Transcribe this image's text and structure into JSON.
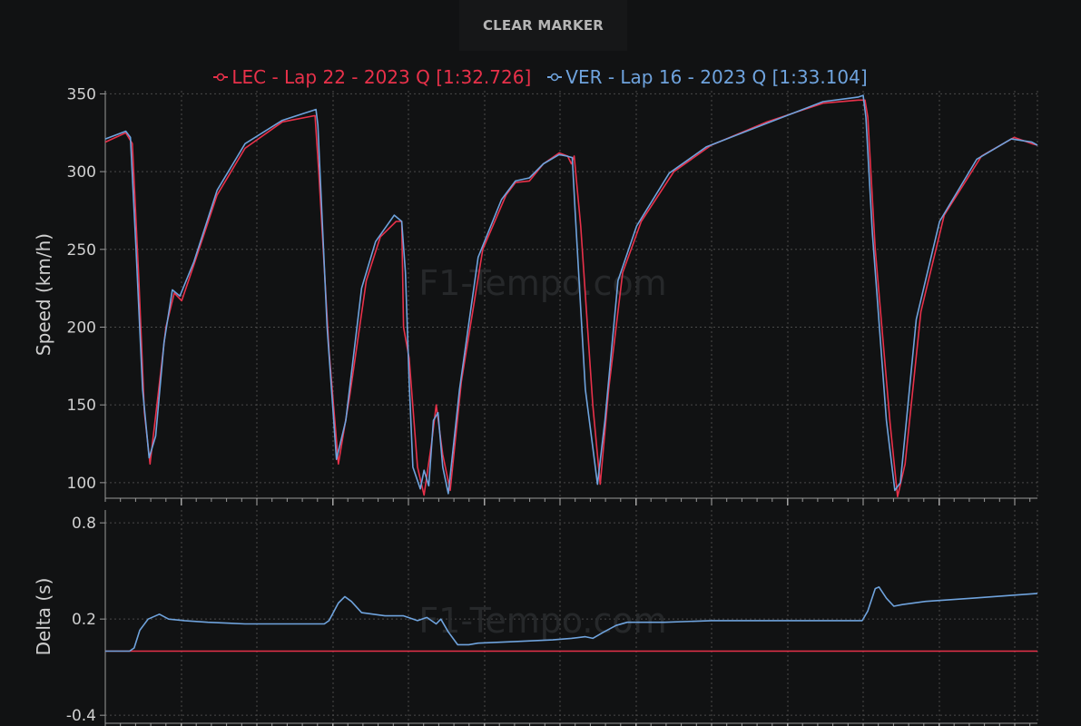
{
  "toolbar": {
    "clear_marker_label": "CLEAR MARKER"
  },
  "watermark": "F1-Tempo.com",
  "colors": {
    "lec": "#e8314a",
    "ver": "#6fa3dd",
    "grid": "#555",
    "axis": "#888"
  },
  "legend": [
    {
      "label": "LEC - Lap 22 - 2023 Q [1:32.726]",
      "color": "#e8314a"
    },
    {
      "label": "VER - Lap 16 - 2023 Q [1:33.104]",
      "color": "#6fa3dd"
    }
  ],
  "chart_data": [
    {
      "type": "line",
      "ylabel": "Speed (km/h)",
      "ylim": [
        90,
        352
      ],
      "xlim": [
        0,
        1
      ],
      "yticks": [
        100,
        150,
        200,
        250,
        300,
        350
      ],
      "grid": true,
      "series": [
        {
          "name": "LEC - Lap 22 - 2023 Q [1:32.726]",
          "color": "#e8314a",
          "points": [
            [
              0,
              319
            ],
            [
              0.022,
              325
            ],
            [
              0.029,
              318
            ],
            [
              0.036,
              230
            ],
            [
              0.042,
              145
            ],
            [
              0.048,
              112
            ],
            [
              0.055,
              148
            ],
            [
              0.065,
              200
            ],
            [
              0.074,
              222
            ],
            [
              0.082,
              217
            ],
            [
              0.095,
              240
            ],
            [
              0.12,
              285
            ],
            [
              0.15,
              315
            ],
            [
              0.19,
              332
            ],
            [
              0.225,
              336
            ],
            [
              0.229,
              300
            ],
            [
              0.24,
              185
            ],
            [
              0.25,
              112
            ],
            [
              0.262,
              155
            ],
            [
              0.28,
              230
            ],
            [
              0.295,
              258
            ],
            [
              0.312,
              268
            ],
            [
              0.318,
              268
            ],
            [
              0.32,
              200
            ],
            [
              0.326,
              180
            ],
            [
              0.335,
              110
            ],
            [
              0.342,
              92
            ],
            [
              0.35,
              125
            ],
            [
              0.355,
              150
            ],
            [
              0.362,
              118
            ],
            [
              0.37,
              95
            ],
            [
              0.382,
              165
            ],
            [
              0.405,
              250
            ],
            [
              0.43,
              285
            ],
            [
              0.44,
              293
            ],
            [
              0.455,
              294
            ],
            [
              0.47,
              305
            ],
            [
              0.487,
              312
            ],
            [
              0.496,
              310
            ],
            [
              0.5,
              305
            ],
            [
              0.503,
              310
            ],
            [
              0.51,
              265
            ],
            [
              0.523,
              150
            ],
            [
              0.531,
              99
            ],
            [
              0.54,
              160
            ],
            [
              0.555,
              235
            ],
            [
              0.575,
              268
            ],
            [
              0.61,
              300
            ],
            [
              0.65,
              317
            ],
            [
              0.71,
              332
            ],
            [
              0.77,
              344
            ],
            [
              0.808,
              346
            ],
            [
              0.815,
              346
            ],
            [
              0.818,
              335
            ],
            [
              0.826,
              250
            ],
            [
              0.842,
              138
            ],
            [
              0.85,
              91
            ],
            [
              0.858,
              112
            ],
            [
              0.875,
              210
            ],
            [
              0.9,
              272
            ],
            [
              0.94,
              310
            ],
            [
              0.975,
              322
            ],
            [
              0.994,
              318
            ],
            [
              1.0,
              317
            ]
          ]
        },
        {
          "name": "VER - Lap 16 - 2023 Q [1:33.104]",
          "color": "#6fa3dd",
          "points": [
            [
              0,
              321
            ],
            [
              0.022,
              326
            ],
            [
              0.027,
              322
            ],
            [
              0.033,
              250
            ],
            [
              0.04,
              160
            ],
            [
              0.047,
              116
            ],
            [
              0.054,
              130
            ],
            [
              0.063,
              190
            ],
            [
              0.072,
              224
            ],
            [
              0.08,
              220
            ],
            [
              0.095,
              242
            ],
            [
              0.12,
              288
            ],
            [
              0.15,
              318
            ],
            [
              0.19,
              333
            ],
            [
              0.226,
              340
            ],
            [
              0.228,
              330
            ],
            [
              0.238,
              200
            ],
            [
              0.248,
              115
            ],
            [
              0.258,
              140
            ],
            [
              0.275,
              225
            ],
            [
              0.29,
              255
            ],
            [
              0.31,
              272
            ],
            [
              0.318,
              268
            ],
            [
              0.322,
              235
            ],
            [
              0.326,
              165
            ],
            [
              0.33,
              110
            ],
            [
              0.338,
              96
            ],
            [
              0.342,
              108
            ],
            [
              0.347,
              98
            ],
            [
              0.352,
              140
            ],
            [
              0.357,
              145
            ],
            [
              0.362,
              110
            ],
            [
              0.368,
              93
            ],
            [
              0.38,
              160
            ],
            [
              0.4,
              245
            ],
            [
              0.425,
              282
            ],
            [
              0.44,
              294
            ],
            [
              0.455,
              296
            ],
            [
              0.47,
              305
            ],
            [
              0.487,
              311
            ],
            [
              0.495,
              310
            ],
            [
              0.501,
              309
            ],
            [
              0.504,
              275
            ],
            [
              0.515,
              160
            ],
            [
              0.528,
              99
            ],
            [
              0.536,
              140
            ],
            [
              0.55,
              230
            ],
            [
              0.57,
              265
            ],
            [
              0.605,
              299
            ],
            [
              0.645,
              316
            ],
            [
              0.705,
              330
            ],
            [
              0.77,
              345
            ],
            [
              0.808,
              348
            ],
            [
              0.813,
              349
            ],
            [
              0.816,
              335
            ],
            [
              0.823,
              260
            ],
            [
              0.838,
              140
            ],
            [
              0.847,
              95
            ],
            [
              0.853,
              100
            ],
            [
              0.87,
              205
            ],
            [
              0.895,
              268
            ],
            [
              0.935,
              308
            ],
            [
              0.972,
              321
            ],
            [
              0.994,
              319
            ],
            [
              1.0,
              317
            ]
          ]
        }
      ]
    },
    {
      "type": "line",
      "ylabel": "Delta (s)",
      "ylim": [
        -0.45,
        0.88
      ],
      "xlim": [
        0,
        1
      ],
      "yticks": [
        -0.4,
        0.2,
        0.8
      ],
      "grid": true,
      "series": [
        {
          "name": "LEC - Lap 22 - 2023 Q [1:32.726]",
          "color": "#e8314a",
          "points": [
            [
              0,
              0.0
            ],
            [
              1.0,
              0.0
            ]
          ]
        },
        {
          "name": "VER - Lap 16 - 2023 Q [1:33.104]",
          "color": "#6fa3dd",
          "points": [
            [
              0,
              0.0
            ],
            [
              0.026,
              0.0
            ],
            [
              0.031,
              0.02
            ],
            [
              0.037,
              0.13
            ],
            [
              0.046,
              0.2
            ],
            [
              0.058,
              0.23
            ],
            [
              0.068,
              0.2
            ],
            [
              0.085,
              0.19
            ],
            [
              0.11,
              0.18
            ],
            [
              0.15,
              0.17
            ],
            [
              0.18,
              0.17
            ],
            [
              0.21,
              0.17
            ],
            [
              0.235,
              0.17
            ],
            [
              0.24,
              0.19
            ],
            [
              0.25,
              0.3
            ],
            [
              0.257,
              0.34
            ],
            [
              0.264,
              0.31
            ],
            [
              0.275,
              0.24
            ],
            [
              0.3,
              0.22
            ],
            [
              0.32,
              0.22
            ],
            [
              0.335,
              0.19
            ],
            [
              0.345,
              0.21
            ],
            [
              0.355,
              0.17
            ],
            [
              0.36,
              0.2
            ],
            [
              0.368,
              0.12
            ],
            [
              0.378,
              0.04
            ],
            [
              0.39,
              0.04
            ],
            [
              0.4,
              0.05
            ],
            [
              0.44,
              0.06
            ],
            [
              0.48,
              0.07
            ],
            [
              0.5,
              0.08
            ],
            [
              0.515,
              0.09
            ],
            [
              0.523,
              0.08
            ],
            [
              0.535,
              0.12
            ],
            [
              0.548,
              0.16
            ],
            [
              0.56,
              0.18
            ],
            [
              0.6,
              0.18
            ],
            [
              0.65,
              0.19
            ],
            [
              0.72,
              0.19
            ],
            [
              0.8,
              0.19
            ],
            [
              0.812,
              0.19
            ],
            [
              0.818,
              0.25
            ],
            [
              0.826,
              0.39
            ],
            [
              0.83,
              0.4
            ],
            [
              0.838,
              0.33
            ],
            [
              0.846,
              0.28
            ],
            [
              0.855,
              0.29
            ],
            [
              0.88,
              0.31
            ],
            [
              0.93,
              0.33
            ],
            [
              1.0,
              0.36
            ]
          ]
        }
      ]
    }
  ]
}
